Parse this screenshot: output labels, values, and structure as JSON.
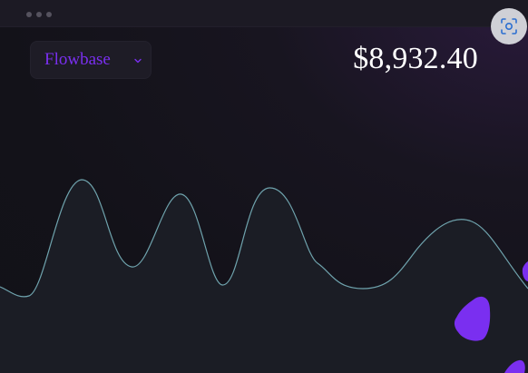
{
  "window": {
    "controls": [
      "dot",
      "dot",
      "dot"
    ]
  },
  "header": {
    "selector": {
      "label": "Flowbase",
      "chevron": "chevron-down-icon"
    },
    "balance": "$8,932.40",
    "capture_icon": "screen-capture-icon"
  },
  "colors": {
    "accent": "#7a2ff0",
    "line": "#6fa3ad",
    "area": "#1b1d25",
    "blob": "#7a2ff0",
    "background": "#131219"
  }
}
